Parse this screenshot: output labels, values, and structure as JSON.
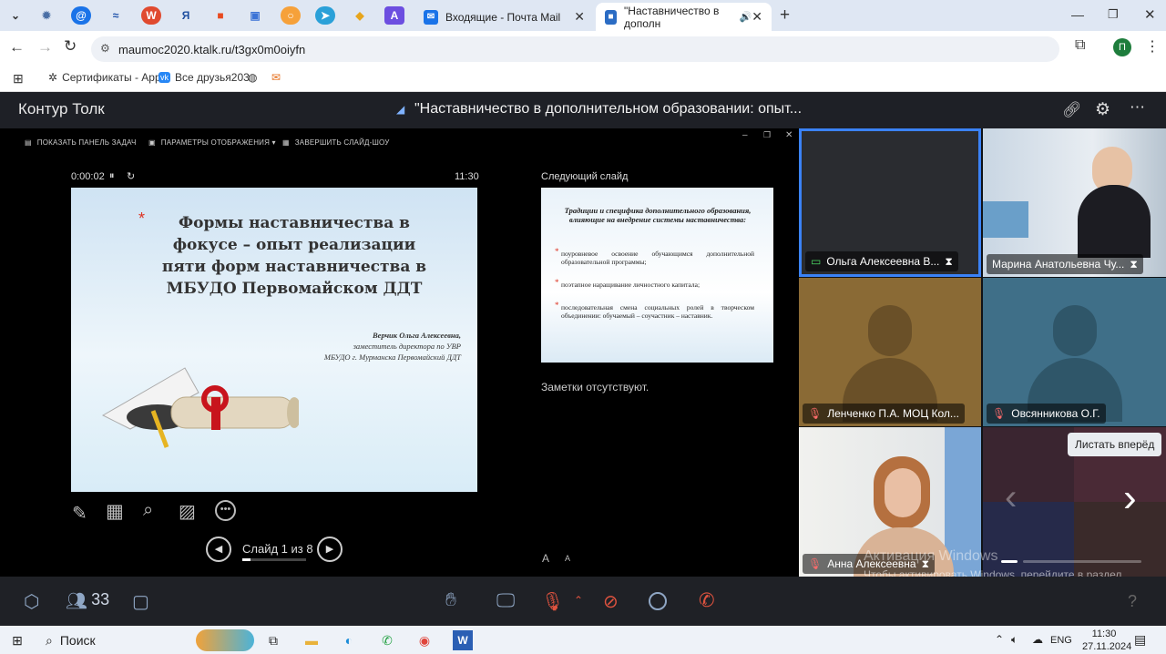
{
  "browser": {
    "pinned_tabs": [
      "settings-icon",
      "mail-ru-icon",
      "sbp-icon",
      "word-icon",
      "yandex-icon",
      "icon",
      "icon",
      "circle-icon",
      "telegram-icon",
      "diamond-icon",
      "alice-icon"
    ],
    "tabs": [
      {
        "title": "Входящие - Почта Mail",
        "active": false
      },
      {
        "title": "\"Наставничество в дополн",
        "active": true
      }
    ],
    "new_tab_label": "+",
    "url": "maumoc2020.ktalk.ru/t3gx0m0oiyfn",
    "profile_initial": "П",
    "bookmarks": [
      {
        "label": "Сертификаты - App",
        "icon": "puzzle-icon"
      },
      {
        "label": "Все друзья203",
        "icon": "vk-icon"
      },
      {
        "label": "",
        "icon": "globe-icon"
      },
      {
        "label": "",
        "icon": "mail-icon"
      }
    ]
  },
  "app": {
    "brand": "Контур Толк",
    "meeting_title": "\"Наставничество в дополнительном образовании: опыт..."
  },
  "presenter": {
    "toolbar": [
      "ПОКАЗАТЬ ПАНЕЛЬ ЗАДАЧ",
      "ПАРАМЕТРЫ ОТОБРАЖЕНИЯ ▾",
      "ЗАВЕРШИТЬ СЛАЙД-ШОУ"
    ],
    "timer": "0:00:02",
    "clock": "11:30",
    "next_slide_label": "Следующий слайд",
    "notes": "Заметки отсутствуют.",
    "slide_counter": "Слайд 1 из 8",
    "slide_progress": 0.125,
    "font_up": "A",
    "font_down": "A",
    "current_slide": {
      "title": "Формы наставничества в фокусе – опыт реализации пяти форм наставничества в МБУДО Первомайском ДДТ",
      "author_name": "Верчик Ольга Алексеевна,",
      "author_role": "заместитель директора по УВР",
      "author_org": "МБУДО г. Мурманска Первомайский ДДТ"
    },
    "next_slide": {
      "title": "Традиции и специфика дополнительного образования, влияющие на внедрение системы наставничества:",
      "items": [
        "поуровневое освоение обучающимся дополнительной образовательной программы;",
        "поэтапное наращивание личностного капитала;",
        "последовательная смена социальных ролей в творческом объединении: обучаемый – соучастник – наставник."
      ]
    }
  },
  "participants": [
    {
      "name": "Ольга Алексеевна В...",
      "muted": false,
      "active": true
    },
    {
      "name": "Марина Анатольевна Чу...",
      "muted": false,
      "active": false
    },
    {
      "name": "Ленченко П.А. МОЦ Кол...",
      "muted": true,
      "active": false
    },
    {
      "name": "Овсянникова О.Г.",
      "muted": true,
      "active": false
    },
    {
      "name": "Анна Алексеевна",
      "muted": true,
      "active": false
    }
  ],
  "tooltip": "Листать вперёд",
  "watermark": {
    "title": "Активация Windows",
    "text": "Чтобы активировать Windows, перейдите в раздел \"Параметры\"."
  },
  "controls": {
    "participants_count": "33",
    "help": "?"
  },
  "taskbar": {
    "search": "Поиск",
    "lang": "ENG",
    "time": "11:30",
    "date": "27.11.2024"
  },
  "colors": {
    "app_bg": "#1f2126",
    "accent_blue": "#3b82f6",
    "end_call_red": "#e0533f"
  }
}
